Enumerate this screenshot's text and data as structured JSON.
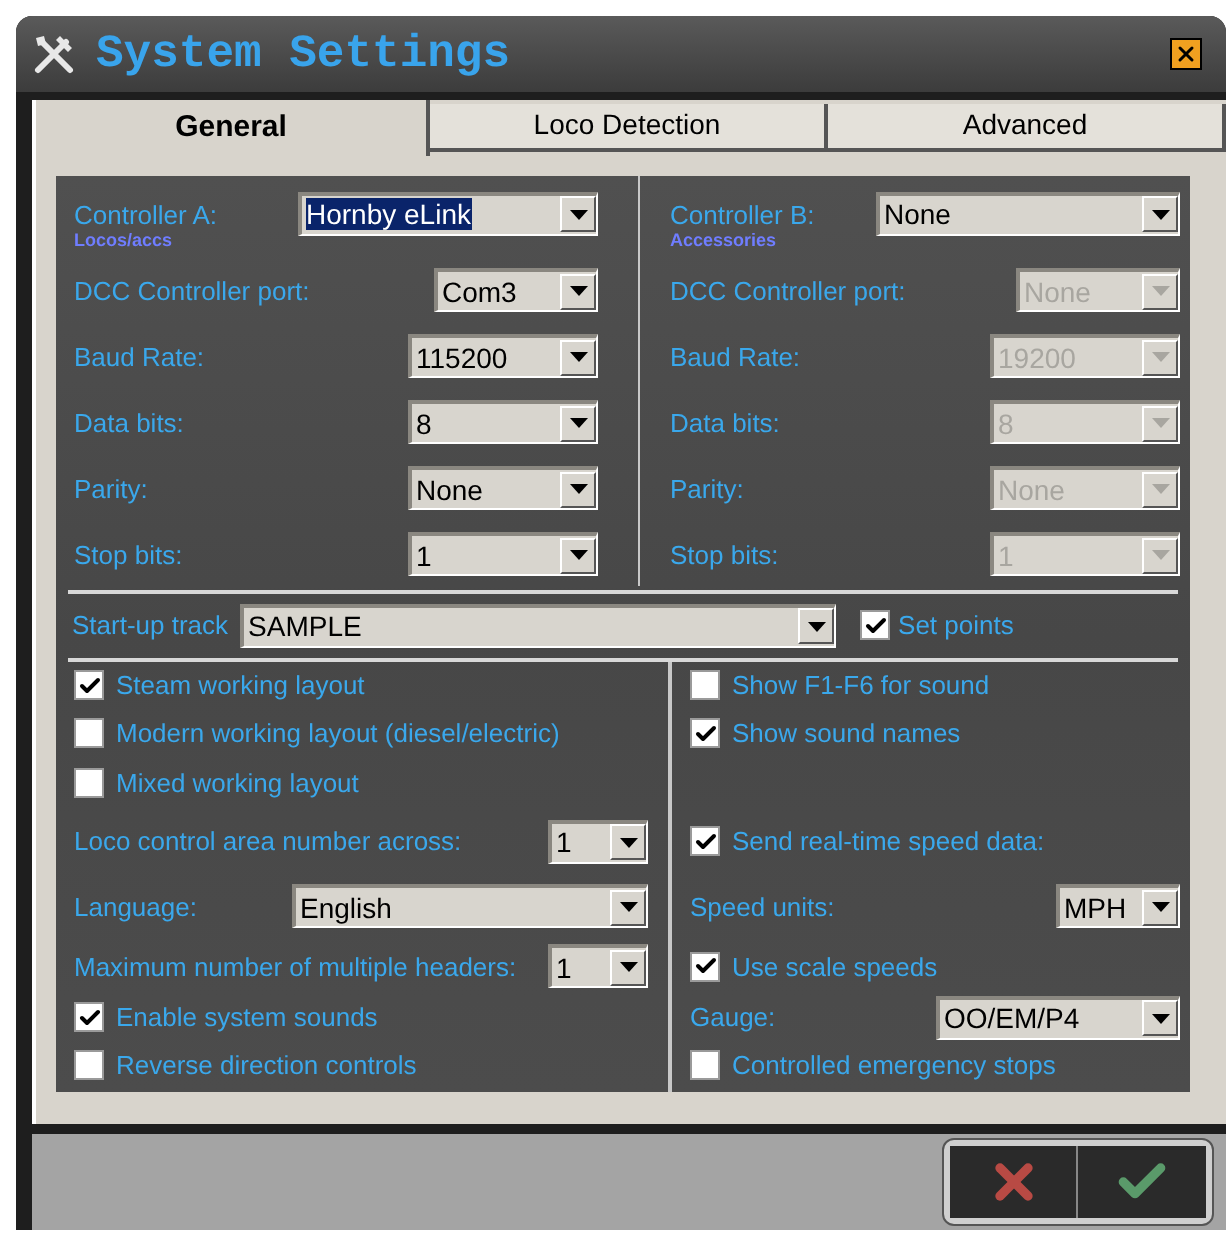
{
  "window": {
    "title": "System Settings"
  },
  "tabs": [
    {
      "label": "General",
      "selected": true
    },
    {
      "label": "Loco Detection",
      "selected": false
    },
    {
      "label": "Advanced",
      "selected": false
    }
  ],
  "controllers": [
    {
      "label": "Controller A:",
      "sublabel": "Locos/accs",
      "value": "Hornby eLink",
      "value_highlighted": true,
      "fields": [
        {
          "label": "DCC Controller port:",
          "value": "Com3",
          "disabled": false
        },
        {
          "label": "Baud Rate:",
          "value": "115200",
          "disabled": false
        },
        {
          "label": "Data bits:",
          "value": "8",
          "disabled": false
        },
        {
          "label": "Parity:",
          "value": "None",
          "disabled": false
        },
        {
          "label": "Stop bits:",
          "value": "1",
          "disabled": false
        }
      ]
    },
    {
      "label": "Controller B:",
      "sublabel": "Accessories",
      "value": "None",
      "value_highlighted": false,
      "fields": [
        {
          "label": "DCC Controller port:",
          "value": "None",
          "disabled": true
        },
        {
          "label": "Baud Rate:",
          "value": "19200",
          "disabled": true
        },
        {
          "label": "Data bits:",
          "value": "8",
          "disabled": true
        },
        {
          "label": "Parity:",
          "value": "None",
          "disabled": true
        },
        {
          "label": "Stop bits:",
          "value": "1",
          "disabled": true
        }
      ]
    }
  ],
  "startup_track": {
    "label": "Start-up track",
    "value": "SAMPLE"
  },
  "set_points": {
    "label": "Set points",
    "checked": true
  },
  "left_options": [
    {
      "kind": "checkbox",
      "label": "Steam working layout",
      "checked": true
    },
    {
      "kind": "checkbox",
      "label": "Modern working layout (diesel/electric)",
      "checked": false
    },
    {
      "kind": "checkbox",
      "label": "Mixed working layout",
      "checked": false
    },
    {
      "kind": "select",
      "label": "Loco control area number across:",
      "value": "1"
    },
    {
      "kind": "select",
      "label": "Language:",
      "value": "English"
    },
    {
      "kind": "select",
      "label": "Maximum number of multiple headers:",
      "value": "1"
    },
    {
      "kind": "checkbox",
      "label": "Enable system sounds",
      "checked": true
    },
    {
      "kind": "checkbox",
      "label": "Reverse direction controls",
      "checked": false
    }
  ],
  "right_options": [
    {
      "kind": "checkbox",
      "label": "Show F1-F6 for sound",
      "checked": false
    },
    {
      "kind": "checkbox",
      "label": "Show sound names",
      "checked": true
    },
    {
      "kind": "checkbox",
      "label": "Send real-time speed data:",
      "checked": true
    },
    {
      "kind": "select",
      "label": "Speed units:",
      "value": "MPH"
    },
    {
      "kind": "checkbox",
      "label": "Use scale speeds",
      "checked": true
    },
    {
      "kind": "select",
      "label": "Gauge:",
      "value": "OO/EM/P4"
    },
    {
      "kind": "checkbox",
      "label": "Controlled emergency stops",
      "checked": false
    }
  ]
}
